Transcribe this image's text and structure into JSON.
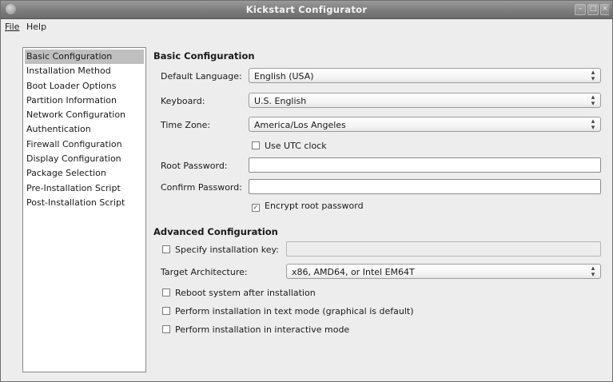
{
  "window": {
    "title": "Kickstart Configurator"
  },
  "menubar": {
    "file": "File",
    "help": "Help"
  },
  "sidebar": {
    "items": [
      {
        "label": "Basic Configuration",
        "selected": true
      },
      {
        "label": "Installation Method"
      },
      {
        "label": "Boot Loader Options"
      },
      {
        "label": "Partition Information"
      },
      {
        "label": "Network Configuration"
      },
      {
        "label": "Authentication"
      },
      {
        "label": "Firewall Configuration"
      },
      {
        "label": "Display Configuration"
      },
      {
        "label": "Package Selection"
      },
      {
        "label": "Pre-Installation Script"
      },
      {
        "label": "Post-Installation Script"
      }
    ]
  },
  "basic": {
    "title": "Basic Configuration",
    "language_label": "Default Language:",
    "language_value": "English (USA)",
    "keyboard_label": "Keyboard:",
    "keyboard_value": "U.S. English",
    "timezone_label": "Time Zone:",
    "timezone_value": "America/Los Angeles",
    "utc_label": "Use UTC clock",
    "utc_checked": false,
    "root_password_label": "Root Password:",
    "root_password_value": "",
    "confirm_password_label": "Confirm Password:",
    "confirm_password_value": "",
    "encrypt_label": "Encrypt root password",
    "encrypt_checked": true
  },
  "advanced": {
    "title": "Advanced Configuration",
    "install_key_label": "Specify installation key:",
    "install_key_value": "",
    "arch_label": "Target Architecture:",
    "arch_value": "x86, AMD64, or Intel EM64T",
    "reboot_label": "Reboot system after installation",
    "text_mode_label": "Perform installation in text mode (graphical is default)",
    "interactive_label": "Perform installation in interactive mode"
  },
  "colors": {
    "titlebar": "#7c7c7c",
    "selection": "#bfbfbf",
    "window_bg": "#ededed"
  }
}
